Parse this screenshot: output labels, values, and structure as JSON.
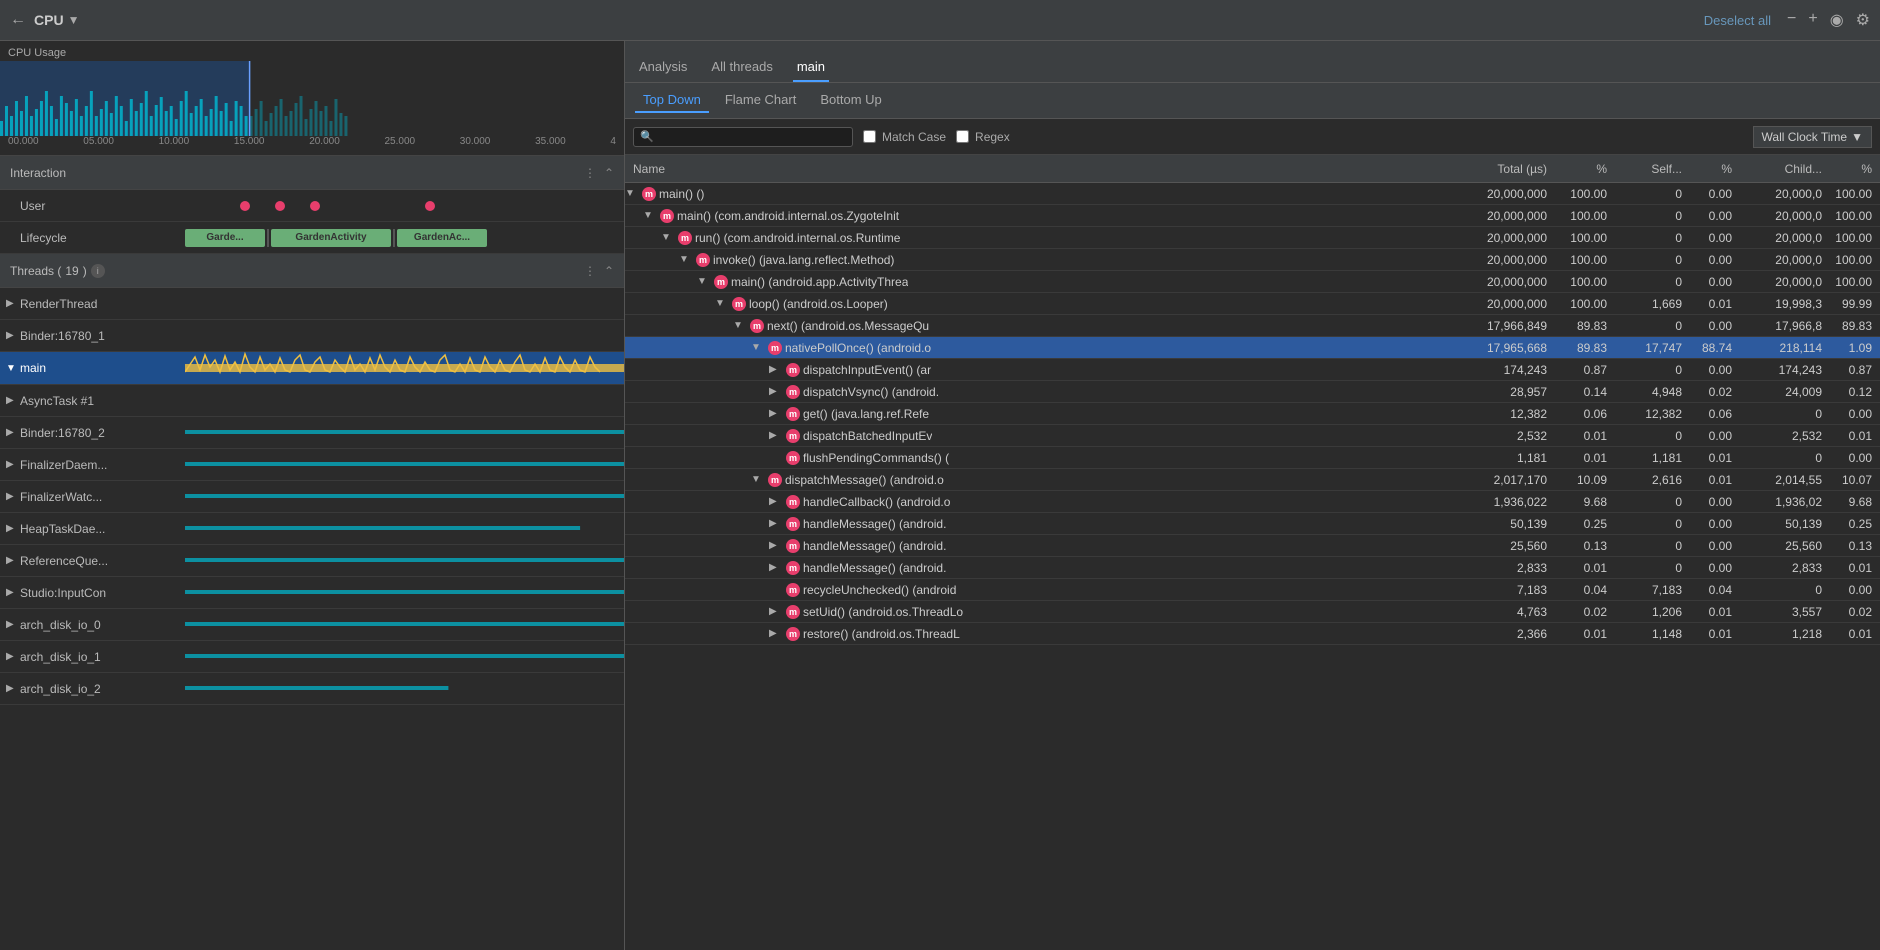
{
  "topbar": {
    "title": "CPU",
    "deselect_all": "Deselect all"
  },
  "left": {
    "cpu_usage_label": "CPU Usage",
    "timeline_ticks": [
      "00.000",
      "05.000",
      "10.000",
      "15.000",
      "20.000",
      "25.000",
      "30.000",
      "35.000",
      "4"
    ],
    "interaction": {
      "title": "Interaction",
      "rows": [
        {
          "label": "User"
        },
        {
          "label": "Lifecycle"
        }
      ]
    },
    "threads": {
      "title": "Threads",
      "count": "19",
      "items": [
        {
          "name": "RenderThread",
          "expanded": false
        },
        {
          "name": "Binder:16780_1",
          "expanded": false
        },
        {
          "name": "main",
          "expanded": true,
          "active": true
        },
        {
          "name": "AsyncTask #1",
          "expanded": false
        },
        {
          "name": "Binder:16780_2",
          "expanded": false
        },
        {
          "name": "FinalizerDaem...",
          "expanded": false
        },
        {
          "name": "FinalizerWatc...",
          "expanded": false
        },
        {
          "name": "HeapTaskDae...",
          "expanded": false
        },
        {
          "name": "ReferenceQue...",
          "expanded": false
        },
        {
          "name": "Studio:InputCon",
          "expanded": false
        },
        {
          "name": "arch_disk_io_0",
          "expanded": false
        },
        {
          "name": "arch_disk_io_1",
          "expanded": false
        },
        {
          "name": "arch_disk_io_2",
          "expanded": false
        }
      ]
    }
  },
  "right": {
    "tabs": [
      {
        "label": "Analysis",
        "active": false
      },
      {
        "label": "All threads",
        "active": false
      },
      {
        "label": "main",
        "active": true
      }
    ],
    "sub_tabs": [
      {
        "label": "Top Down",
        "active": true
      },
      {
        "label": "Flame Chart",
        "active": false
      },
      {
        "label": "Bottom Up",
        "active": false
      }
    ],
    "search_placeholder": "🔍",
    "match_case_label": "Match Case",
    "regex_label": "Regex",
    "wall_clock_label": "Wall Clock Time",
    "columns": {
      "name": "Name",
      "total": "Total (µs)",
      "pct": "%",
      "self": "Self...",
      "pct2": "%",
      "child": "Child...",
      "pct3": "%"
    },
    "rows": [
      {
        "indent": 0,
        "expanded": true,
        "has_expand": true,
        "icon": "m",
        "label": "main() ()",
        "total": "20,000,000",
        "pct": "100.00",
        "self": "0",
        "pct2": "0.00",
        "child": "20,000,0",
        "pct3": "100.00"
      },
      {
        "indent": 1,
        "expanded": true,
        "has_expand": true,
        "icon": "m",
        "label": "main() (com.android.internal.os.ZygoteInit",
        "total": "20,000,000",
        "pct": "100.00",
        "self": "0",
        "pct2": "0.00",
        "child": "20,000,0",
        "pct3": "100.00"
      },
      {
        "indent": 2,
        "expanded": true,
        "has_expand": true,
        "icon": "m",
        "label": "run() (com.android.internal.os.Runtime",
        "total": "20,000,000",
        "pct": "100.00",
        "self": "0",
        "pct2": "0.00",
        "child": "20,000,0",
        "pct3": "100.00"
      },
      {
        "indent": 3,
        "expanded": true,
        "has_expand": true,
        "icon": "m",
        "label": "invoke() (java.lang.reflect.Method)",
        "total": "20,000,000",
        "pct": "100.00",
        "self": "0",
        "pct2": "0.00",
        "child": "20,000,0",
        "pct3": "100.00"
      },
      {
        "indent": 4,
        "expanded": true,
        "has_expand": true,
        "icon": "m",
        "label": "main() (android.app.ActivityThrea",
        "total": "20,000,000",
        "pct": "100.00",
        "self": "0",
        "pct2": "0.00",
        "child": "20,000,0",
        "pct3": "100.00"
      },
      {
        "indent": 5,
        "expanded": true,
        "has_expand": true,
        "icon": "m",
        "label": "loop() (android.os.Looper)",
        "total": "20,000,000",
        "pct": "100.00",
        "self": "1,669",
        "pct2": "0.01",
        "child": "19,998,3",
        "pct3": "99.99"
      },
      {
        "indent": 6,
        "expanded": true,
        "has_expand": true,
        "icon": "m",
        "label": "next() (android.os.MessageQu",
        "total": "17,966,849",
        "pct": "89.83",
        "self": "0",
        "pct2": "0.00",
        "child": "17,966,8",
        "pct3": "89.83"
      },
      {
        "indent": 7,
        "expanded": true,
        "has_expand": true,
        "selected": true,
        "icon": "m",
        "label": "nativePollOnce() (android.o",
        "total": "17,965,668",
        "pct": "89.83",
        "self": "17,747",
        "pct2": "88.74",
        "child": "218,114",
        "pct3": "1.09"
      },
      {
        "indent": 8,
        "expanded": false,
        "has_expand": true,
        "icon": "m",
        "label": "dispatchInputEvent() (ar",
        "total": "174,243",
        "pct": "0.87",
        "self": "0",
        "pct2": "0.00",
        "child": "174,243",
        "pct3": "0.87"
      },
      {
        "indent": 8,
        "expanded": false,
        "has_expand": true,
        "icon": "m",
        "label": "dispatchVsync() (android.",
        "total": "28,957",
        "pct": "0.14",
        "self": "4,948",
        "pct2": "0.02",
        "child": "24,009",
        "pct3": "0.12"
      },
      {
        "indent": 8,
        "expanded": false,
        "has_expand": true,
        "icon": "m",
        "label": "get() (java.lang.ref.Refe",
        "total": "12,382",
        "pct": "0.06",
        "self": "12,382",
        "pct2": "0.06",
        "child": "0",
        "pct3": "0.00"
      },
      {
        "indent": 8,
        "expanded": false,
        "has_expand": true,
        "icon": "m",
        "label": "dispatchBatchedInputEv",
        "total": "2,532",
        "pct": "0.01",
        "self": "0",
        "pct2": "0.00",
        "child": "2,532",
        "pct3": "0.01"
      },
      {
        "indent": 8,
        "expanded": false,
        "has_expand": false,
        "icon": "m",
        "label": "flushPendingCommands() (",
        "total": "1,181",
        "pct": "0.01",
        "self": "1,181",
        "pct2": "0.01",
        "child": "0",
        "pct3": "0.00"
      },
      {
        "indent": 7,
        "expanded": true,
        "has_expand": true,
        "icon": "m",
        "label": "dispatchMessage() (android.o",
        "total": "2,017,170",
        "pct": "10.09",
        "self": "2,616",
        "pct2": "0.01",
        "child": "2,014,55",
        "pct3": "10.07"
      },
      {
        "indent": 8,
        "expanded": false,
        "has_expand": true,
        "icon": "m",
        "label": "handleCallback() (android.o",
        "total": "1,936,022",
        "pct": "9.68",
        "self": "0",
        "pct2": "0.00",
        "child": "1,936,02",
        "pct3": "9.68"
      },
      {
        "indent": 8,
        "expanded": false,
        "has_expand": true,
        "icon": "m",
        "label": "handleMessage() (android.",
        "total": "50,139",
        "pct": "0.25",
        "self": "0",
        "pct2": "0.00",
        "child": "50,139",
        "pct3": "0.25"
      },
      {
        "indent": 8,
        "expanded": false,
        "has_expand": true,
        "icon": "m",
        "label": "handleMessage() (android.",
        "total": "25,560",
        "pct": "0.13",
        "self": "0",
        "pct2": "0.00",
        "child": "25,560",
        "pct3": "0.13"
      },
      {
        "indent": 8,
        "expanded": false,
        "has_expand": true,
        "icon": "m",
        "label": "handleMessage() (android.",
        "total": "2,833",
        "pct": "0.01",
        "self": "0",
        "pct2": "0.00",
        "child": "2,833",
        "pct3": "0.01"
      },
      {
        "indent": 8,
        "expanded": false,
        "has_expand": false,
        "icon": "m",
        "label": "recycleUnchecked() (android",
        "total": "7,183",
        "pct": "0.04",
        "self": "7,183",
        "pct2": "0.04",
        "child": "0",
        "pct3": "0.00"
      },
      {
        "indent": 8,
        "expanded": false,
        "has_expand": true,
        "icon": "m",
        "label": "setUid() (android.os.ThreadLo",
        "total": "4,763",
        "pct": "0.02",
        "self": "1,206",
        "pct2": "0.01",
        "child": "3,557",
        "pct3": "0.02"
      },
      {
        "indent": 8,
        "expanded": false,
        "has_expand": true,
        "icon": "m",
        "label": "restore() (android.os.ThreadL",
        "total": "2,366",
        "pct": "0.01",
        "self": "1,148",
        "pct2": "0.01",
        "child": "1,218",
        "pct3": "0.01"
      }
    ]
  }
}
